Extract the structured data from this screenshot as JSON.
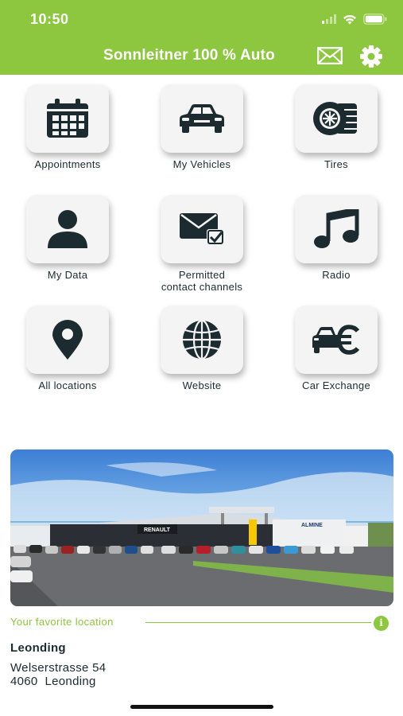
{
  "status_bar": {
    "time": "10:50"
  },
  "header": {
    "title": "Sonnleitner 100 % Auto"
  },
  "tiles": [
    {
      "label": "Appointments",
      "icon": "calendar-icon"
    },
    {
      "label": "My Vehicles",
      "icon": "car-icon"
    },
    {
      "label": "Tires",
      "icon": "tire-icon"
    },
    {
      "label": "My Data",
      "icon": "person-icon"
    },
    {
      "label": "Permitted\ncontact channels",
      "icon": "mail-check-icon"
    },
    {
      "label": "Radio",
      "icon": "music-note-icon"
    },
    {
      "label": "All locations",
      "icon": "map-pin-icon"
    },
    {
      "label": "Website",
      "icon": "globe-icon"
    },
    {
      "label": "Car Exchange",
      "icon": "car-euro-icon"
    }
  ],
  "photo": {
    "dealer_sign": "RENAULT",
    "building_sign": "ALMINE"
  },
  "favorite": {
    "label": "Your favorite location",
    "name": "Leonding",
    "street": "Welserstrasse 54",
    "city": "4060  Leonding"
  },
  "colors": {
    "accent": "#8dc63f",
    "icon_dark": "#1c2b30",
    "tile_bg": "#f4f4f4"
  }
}
